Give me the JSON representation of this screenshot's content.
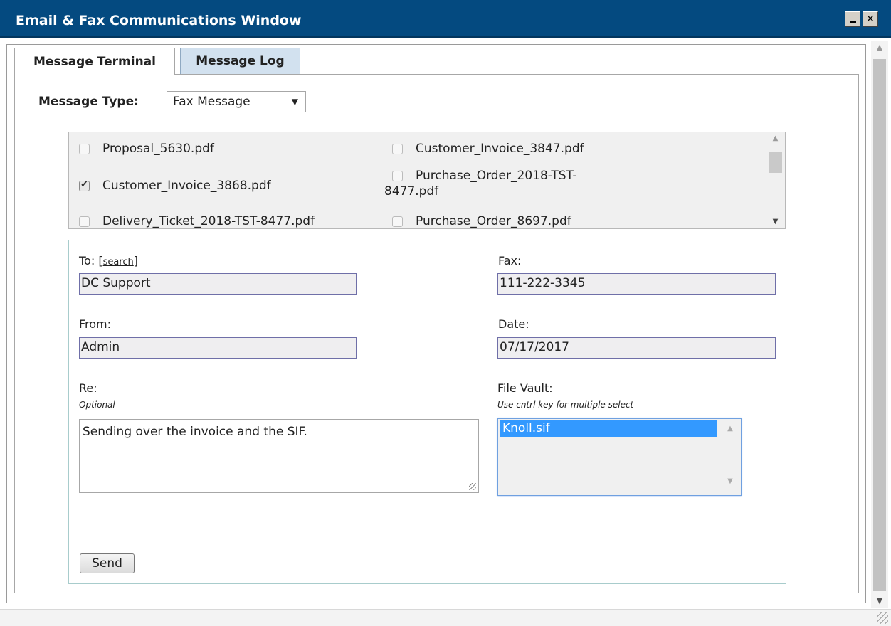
{
  "window": {
    "title": "Email & Fax Communications Window",
    "minimize_icon": "minimize-icon",
    "close_glyph": "✕"
  },
  "tabs": [
    {
      "label": "Message Terminal",
      "active": true
    },
    {
      "label": "Message Log",
      "active": false
    }
  ],
  "message_type": {
    "label": "Message Type:",
    "selected": "Fax Message",
    "arrow": "▼"
  },
  "attachments": [
    {
      "name": "Proposal_5630.pdf",
      "checked": false
    },
    {
      "name": "Customer_Invoice_3847.pdf",
      "checked": false
    },
    {
      "name": "Customer_Invoice_3868.pdf",
      "checked": true
    },
    {
      "name_line1": "Purchase_Order_2018-TST-",
      "name_line2": "8477.pdf",
      "checked": false
    },
    {
      "name": "Delivery_Ticket_2018-TST-8477.pdf",
      "checked": false
    },
    {
      "name": "Purchase_Order_8697.pdf",
      "checked": false
    }
  ],
  "form": {
    "to_label": "To:",
    "search_link": "search",
    "to_value": "DC Support",
    "fax_label": "Fax:",
    "fax_value": "111-222-3345",
    "from_label": "From:",
    "from_value": "Admin",
    "date_label": "Date:",
    "date_value": "07/17/2017",
    "re_label": "Re:",
    "re_hint": "Optional",
    "re_value": "Sending over the invoice and the SIF.",
    "vault_label": "File Vault:",
    "vault_hint": "Use cntrl key for multiple select",
    "vault_items": [
      "Knoll.sif"
    ],
    "send_label": "Send"
  },
  "scroll_arrows": {
    "up": "▲",
    "down": "▼"
  },
  "colors": {
    "titlebar": "#044a80",
    "active_tab_bg": "#ffffff",
    "inactive_tab_bg": "#d2e1ef",
    "selection": "#3399ff"
  }
}
